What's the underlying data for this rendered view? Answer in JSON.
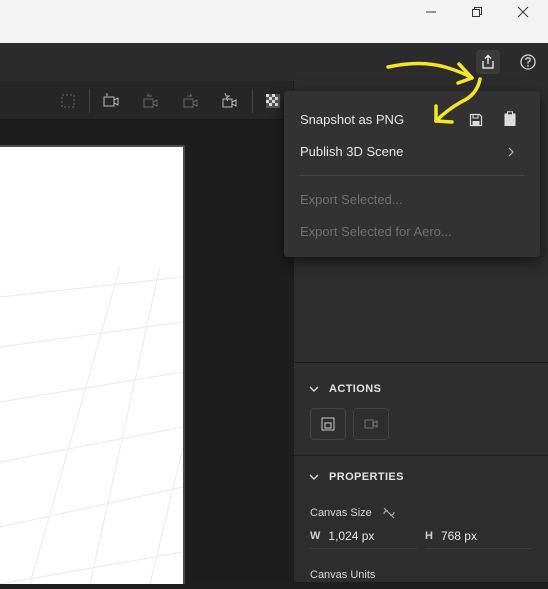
{
  "menu": {
    "snapshot_label": "Snapshot as PNG",
    "publish_label": "Publish 3D Scene",
    "export_selected_label": "Export Selected...",
    "export_aero_label": "Export Selected for Aero..."
  },
  "actions": {
    "header": "ACTIONS"
  },
  "properties": {
    "header": "PROPERTIES",
    "canvas_size_label": "Canvas Size",
    "width_axis": "W",
    "width_value": "1,024 px",
    "height_axis": "H",
    "height_value": "768 px",
    "canvas_units_label": "Canvas Units"
  },
  "icons": {
    "minimize": "minimize-icon",
    "restore": "restore-icon",
    "close": "close-icon",
    "share": "share-icon",
    "help": "help-icon",
    "save": "save-icon",
    "clipboard": "clipboard-icon",
    "link_off": "unlink-icon"
  },
  "colors": {
    "annotation": "#f5e52a",
    "panel_bg": "#2d2d2d",
    "menu_bg": "#323232"
  }
}
